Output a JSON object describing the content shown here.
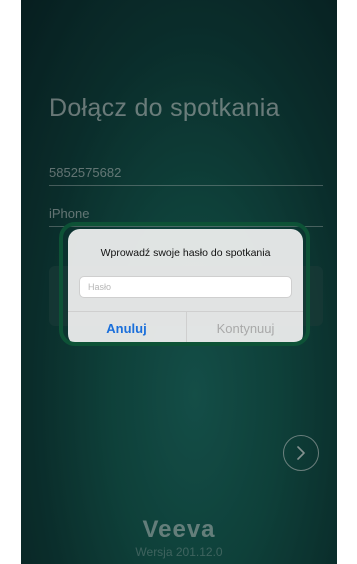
{
  "screen": {
    "title": "Dołącz do spotkania",
    "meeting_id_value": "5852575682",
    "device_name_value": "iPhone",
    "next_icon": "chevron-right-icon",
    "brand": "Veeva",
    "version": "Wersja 201.12.0"
  },
  "dialog": {
    "title": "Wprowadź swoje hasło do spotkania",
    "password_placeholder": "Hasło",
    "cancel_label": "Anuluj",
    "continue_label": "Kontynuuj"
  },
  "colors": {
    "accent": "#1a6fdb",
    "highlight": "#0d5236",
    "background": "#145950"
  }
}
